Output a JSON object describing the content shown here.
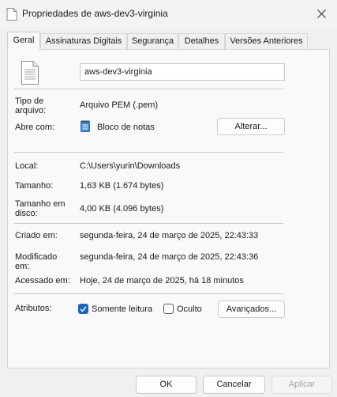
{
  "window": {
    "title": "Propriedades de aws-dev3-virginia",
    "title_icon": "document-icon",
    "close_icon": "close-icon"
  },
  "tabs": [
    {
      "label": "Geral",
      "active": true
    },
    {
      "label": "Assinaturas Digitais",
      "active": false
    },
    {
      "label": "Segurança",
      "active": false
    },
    {
      "label": "Detalhes",
      "active": false
    },
    {
      "label": "Versões Anteriores",
      "active": false
    }
  ],
  "general": {
    "file_icon": "document-icon",
    "file_name": "aws-dev3-virginia",
    "type_label": "Tipo de\narquivo:",
    "type_value": "Arquivo PEM (.pem)",
    "opens_with_label": "Abre com:",
    "opens_with_icon": "notepad-icon",
    "opens_with_value": "Bloco de notas",
    "change_button": "Alterar...",
    "location_label": "Local:",
    "location_value": "C:\\Users\\yurin\\Downloads",
    "size_label": "Tamanho:",
    "size_value": "1,63 KB (1.674 bytes)",
    "size_on_disk_label": "Tamanho em\ndisco:",
    "size_on_disk_value": "4,00 KB (4.096 bytes)",
    "created_label": "Criado em:",
    "created_value": "segunda-feira, 24 de março de 2025, 22:43:33",
    "modified_label": "Modificado\nem:",
    "modified_value": "segunda-feira, 24 de março de 2025, 22:43:36",
    "accessed_label": "Acessado em:",
    "accessed_value": "Hoje, 24 de março de 2025, há 18 minutos",
    "attributes_label": "Atributos:",
    "readonly_label": "Somente leitura",
    "readonly_checked": true,
    "hidden_label": "Oculto",
    "hidden_checked": false,
    "advanced_button": "Avançados..."
  },
  "footer": {
    "ok": "OK",
    "cancel": "Cancelar",
    "apply": "Aplicar"
  },
  "colors": {
    "accent": "#1a64c2",
    "panel_bg": "#f9f9f9",
    "window_bg": "#f0f0f0"
  }
}
